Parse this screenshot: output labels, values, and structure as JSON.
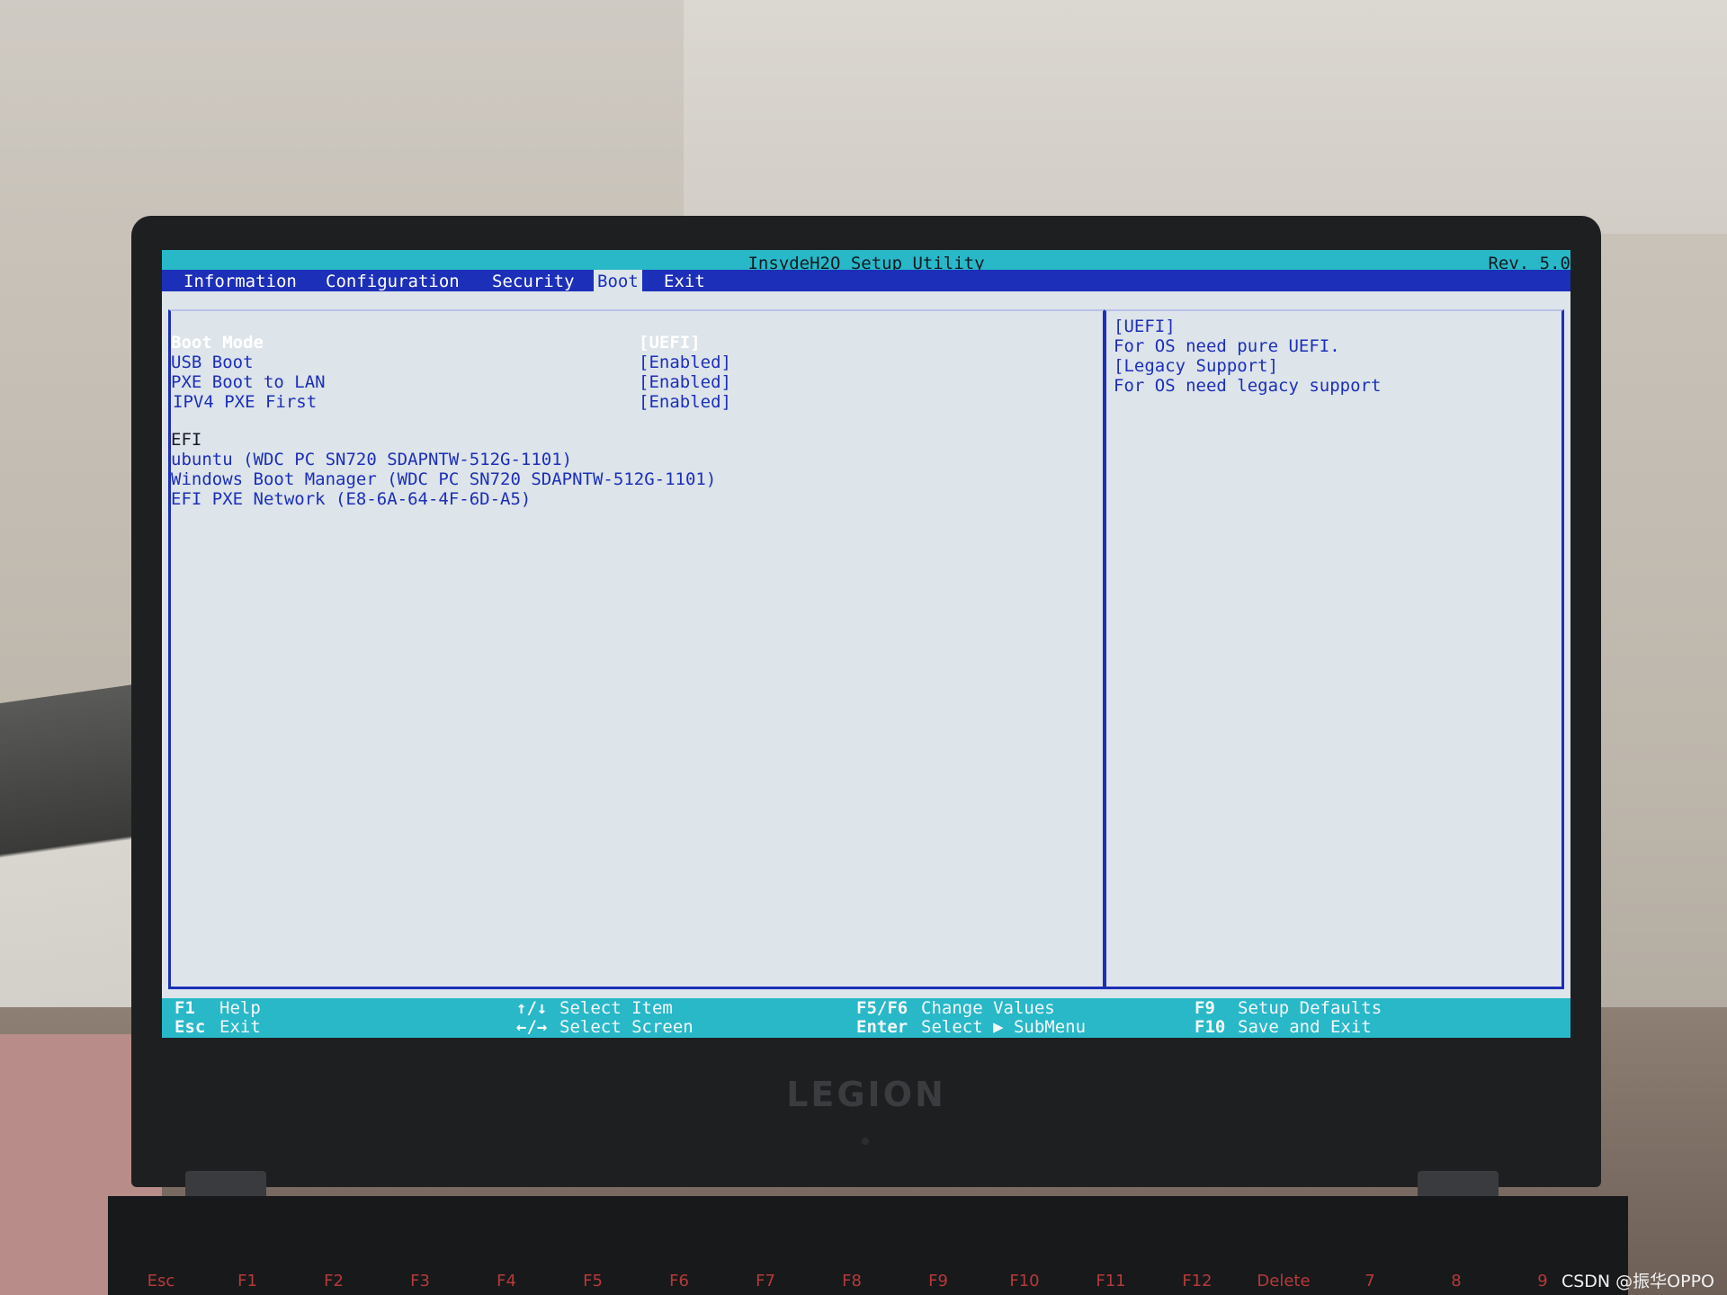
{
  "bios": {
    "title": "InsydeH2O Setup Utility",
    "revision": "Rev. 5.0",
    "tabs": [
      {
        "label": "Information"
      },
      {
        "label": "Configuration"
      },
      {
        "label": "Security"
      },
      {
        "label": "Boot"
      },
      {
        "label": "Exit"
      }
    ],
    "active_tab": "Boot",
    "settings": [
      {
        "label": "Boot Mode",
        "value": "[UEFI]"
      },
      {
        "label": "USB Boot",
        "value": "[Enabled]"
      },
      {
        "label": "PXE Boot to LAN",
        "value": "[Enabled]"
      },
      {
        "label": "IPV4 PXE First",
        "value": "[Enabled]"
      }
    ],
    "boot_section_heading": "EFI",
    "boot_entries": [
      "ubuntu (WDC PC SN720 SDAPNTW-512G-1101)",
      "Windows Boot Manager (WDC PC SN720 SDAPNTW-512G-1101)",
      "EFI PXE Network (E8-6A-64-4F-6D-A5)"
    ],
    "help_lines": [
      "[UEFI]",
      "For OS need pure UEFI.",
      "[Legacy Support]",
      "For OS need legacy support"
    ],
    "footer": {
      "f1_key": "F1",
      "f1_desc": "Help",
      "esc_key": "Esc",
      "esc_desc": "Exit",
      "updown_key": "↑/↓",
      "updown_desc": "Select Item",
      "leftright_key": "←/→",
      "leftright_desc": "Select Screen",
      "f5f6_key": "F5/F6",
      "f5f6_desc": "Change Values",
      "enter_key": "Enter",
      "enter_desc": "Select ▶ SubMenu",
      "f9_key": "F9",
      "f9_desc": "Setup Defaults",
      "f10_key": "F10",
      "f10_desc": "Save and Exit"
    }
  },
  "laptop": {
    "logo": "LEGION",
    "keys": [
      "Esc",
      "F1",
      "F2",
      "F3",
      "F4",
      "F5",
      "F6",
      "F7",
      "F8",
      "F9",
      "F10",
      "F11",
      "F12",
      "Delete",
      "7",
      "8",
      "9"
    ]
  },
  "watermark": "CSDN @振华OPPO"
}
